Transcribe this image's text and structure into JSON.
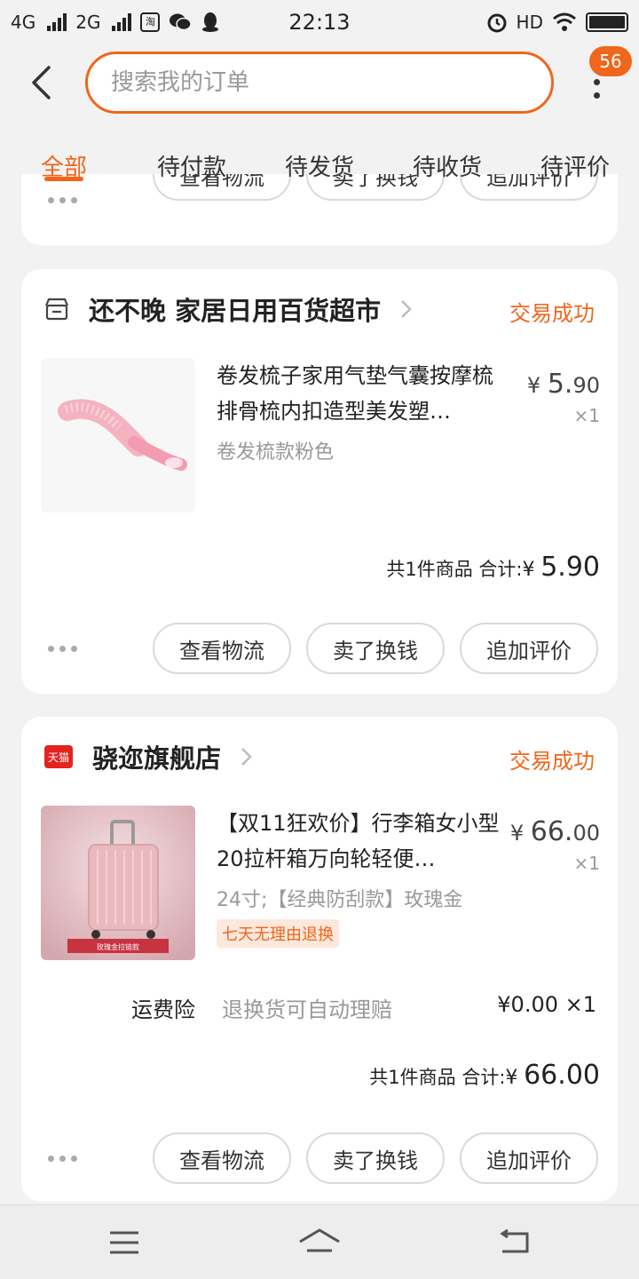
{
  "status_bar": {
    "network1": "4G",
    "network2": "2G",
    "taobao_icon_text": "淘",
    "time": "22:13",
    "hd": "HD"
  },
  "search": {
    "placeholder": "搜索我的订单",
    "badge": "56"
  },
  "tabs": [
    {
      "label": "全部",
      "active": true
    },
    {
      "label": "待付款"
    },
    {
      "label": "待发货"
    },
    {
      "label": "待收货"
    },
    {
      "label": "待评价"
    }
  ],
  "orders": [
    {
      "shop": "还不晚 家居日用百货超市",
      "shop_icon": "store-icon",
      "status": "交易成功",
      "product": {
        "title": "卷发梳子家用气垫气囊按摩梳排骨梳内扣造型美发塑…",
        "spec": "卷发梳款粉色",
        "price_symbol": "¥",
        "price_int": "5.",
        "price_dec": "90",
        "qty": "×1"
      },
      "summary": {
        "count_text": "共1件商品",
        "total_label": "合计:",
        "total_symbol": "¥",
        "total_int": "5.",
        "total_dec": "90"
      },
      "buttons": [
        "查看物流",
        "卖了换钱",
        "追加评价"
      ]
    },
    {
      "shop": "骁迩旗舰店",
      "shop_icon": "tmall-icon",
      "shop_icon_text": "天猫",
      "status": "交易成功",
      "product": {
        "title": "【双11狂欢价】行李箱女小型20拉杆箱万向轮轻便…",
        "spec": "24寸;【经典防刮款】玫瑰金",
        "tag": "七天无理由退换",
        "price_symbol": "¥",
        "price_int": "66.",
        "price_dec": "00",
        "qty": "×1",
        "image_caption": "玫瑰金拉链款"
      },
      "insurance": {
        "name": "运费险",
        "desc": "退换货可自动理赔",
        "price": "¥0.00 ×1"
      },
      "summary": {
        "count_text": "共1件商品",
        "total_label": "合计:",
        "total_symbol": "¥",
        "total_int": "66.",
        "total_dec": "00"
      },
      "buttons": [
        "查看物流",
        "卖了换钱",
        "追加评价"
      ]
    }
  ],
  "partial_buttons": [
    "查看物流",
    "卖了换钱",
    "追加评价"
  ],
  "colors": {
    "accent": "#f0661c",
    "background": "#f2f2f2"
  }
}
